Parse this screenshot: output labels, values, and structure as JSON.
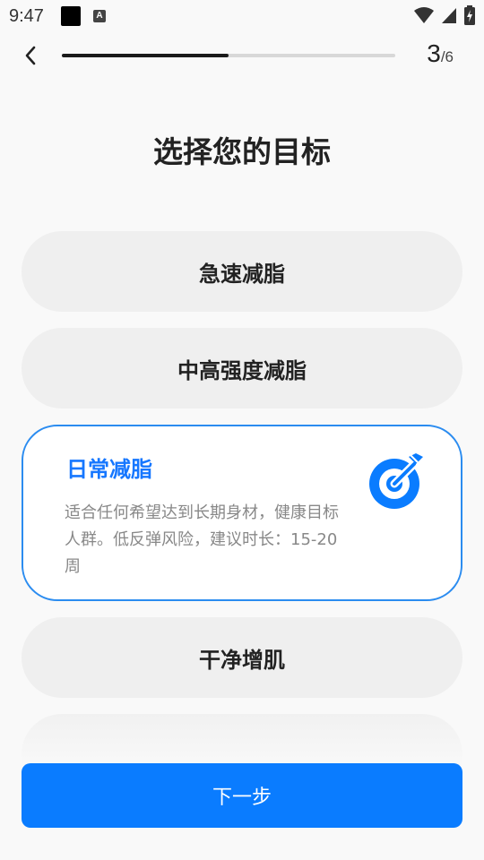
{
  "status_bar": {
    "time": "9:47",
    "notification_icon_label": "A",
    "icons": [
      "wifi-icon",
      "signal-icon",
      "battery-icon"
    ]
  },
  "header": {
    "step_current": "3",
    "step_total": "/6",
    "progress": 0.5
  },
  "page": {
    "title": "选择您的目标"
  },
  "goals": [
    {
      "label": "急速减脂",
      "selected": false
    },
    {
      "label": "中高强度减脂",
      "selected": false
    },
    {
      "label": "日常减脂",
      "selected": true,
      "description": "适合任何希望达到长期身材，健康目标人群。低反弹风险，建议时长：15-20周",
      "icon": "target-icon"
    },
    {
      "label": "干净增肌",
      "selected": false
    }
  ],
  "footer": {
    "next_label": "下一步"
  },
  "colors": {
    "accent": "#0a7cff",
    "selected_border": "#2b8cf0",
    "selected_title": "#1677ff",
    "card_bg": "#efefef",
    "page_bg": "#f9f9f9"
  }
}
